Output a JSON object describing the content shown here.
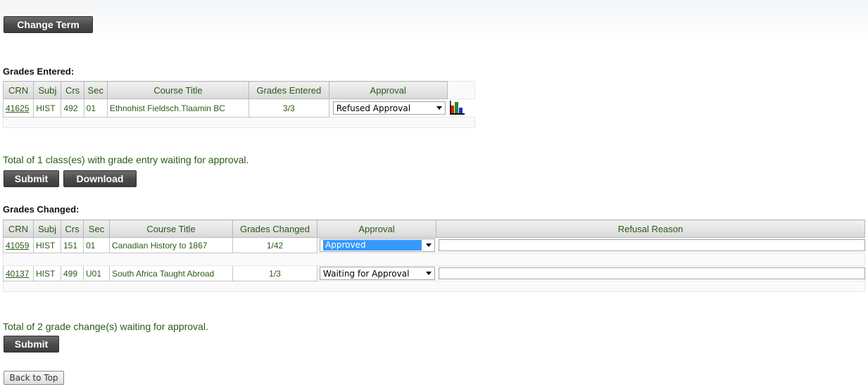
{
  "buttons": {
    "change_term": "Change Term",
    "submit": "Submit",
    "download": "Download",
    "back_to_top": "Back to Top"
  },
  "grades_entered": {
    "title": "Grades Entered:",
    "headers": [
      "CRN",
      "Subj",
      "Crs",
      "Sec",
      "Course Title",
      "Grades Entered",
      "Approval"
    ],
    "rows": [
      {
        "crn": "41625",
        "subj": "HIST",
        "crs": "492",
        "sec": "01",
        "title": "Ethnohist Fieldsch.Tlaamin BC",
        "grades": "3/3",
        "approval": "Refused Approval"
      }
    ],
    "total_text": "Total of 1 class(es) with grade entry waiting for approval."
  },
  "grades_changed": {
    "title": "Grades Changed:",
    "headers": [
      "CRN",
      "Subj",
      "Crs",
      "Sec",
      "Course Title",
      "Grades Changed",
      "Approval",
      "Refusal Reason"
    ],
    "rows": [
      {
        "crn": "41059",
        "subj": "HIST",
        "crs": "151",
        "sec": "01",
        "title": "Canadian History to 1867",
        "grades": "1/42",
        "approval": "Approved",
        "reason": ""
      },
      {
        "crn": "40137",
        "subj": "HIST",
        "crs": "499",
        "sec": "U01",
        "title": "South Africa Taught Abroad",
        "grades": "1/3",
        "approval": "Waiting for Approval",
        "reason": ""
      }
    ],
    "total_text": "Total of 2 grade change(s) waiting for approval."
  },
  "icons": {
    "chart": "bar-chart-icon"
  },
  "colors": {
    "link_green": "#2a5b17",
    "button_dark": "#4a4a4a",
    "selection_blue": "#3399ff"
  }
}
